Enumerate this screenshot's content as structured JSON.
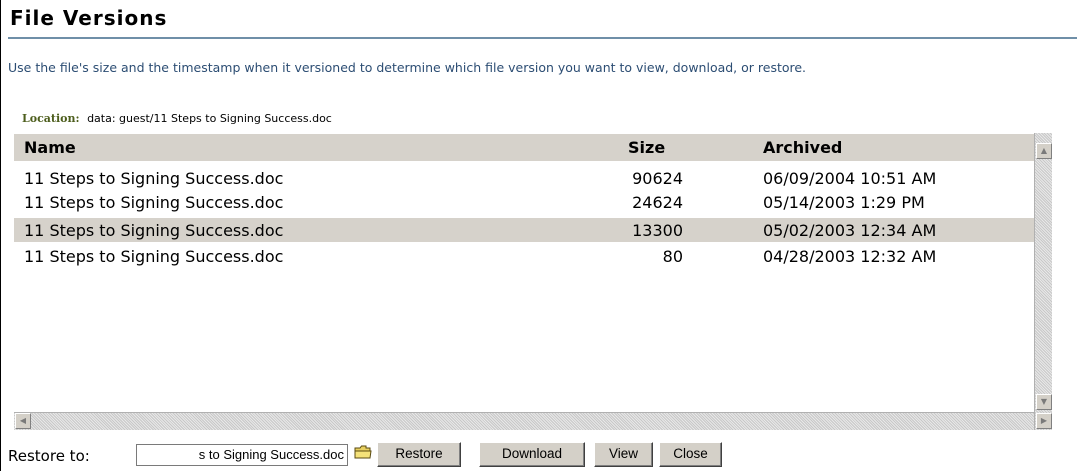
{
  "page": {
    "title": "File Versions",
    "instructions": "Use the file's size and the timestamp when it versioned to determine which file version you want to view, download, or restore."
  },
  "location": {
    "label": "Location:",
    "value": "data: guest/11 Steps to Signing Success.doc"
  },
  "list": {
    "columns": {
      "name": "Name",
      "size": "Size",
      "archived": "Archived"
    },
    "rows": [
      {
        "name": "11 Steps to Signing Success.doc",
        "size": "90624",
        "archived": "06/09/2004 10:51 AM",
        "selected": false
      },
      {
        "name": "11 Steps to Signing Success.doc",
        "size": "24624",
        "archived": "05/14/2003 1:29 PM",
        "selected": false
      },
      {
        "name": "11 Steps to Signing Success.doc",
        "size": "13300",
        "archived": "05/02/2003 12:34 AM",
        "selected": true
      },
      {
        "name": "11 Steps to Signing Success.doc",
        "size": "80",
        "archived": "04/28/2003 12:32 AM",
        "selected": false
      }
    ]
  },
  "restore": {
    "label": "Restore to:",
    "value": "s to Signing Success.doc"
  },
  "buttons": {
    "restore": "Restore",
    "download": "Download",
    "view": "View",
    "close": "Close"
  },
  "colors": {
    "header_bg": "#d6d2cb",
    "selected_bg": "#d6d2cb",
    "instructions_text": "#2c4d73",
    "location_label": "#4d5e1d",
    "title_rule": "#6f8fa8"
  },
  "icons": {
    "browse": "folder-icon",
    "scroll_up": "arrow-up-icon",
    "scroll_down": "arrow-down-icon",
    "scroll_left": "arrow-left-icon",
    "scroll_right": "arrow-right-icon"
  }
}
